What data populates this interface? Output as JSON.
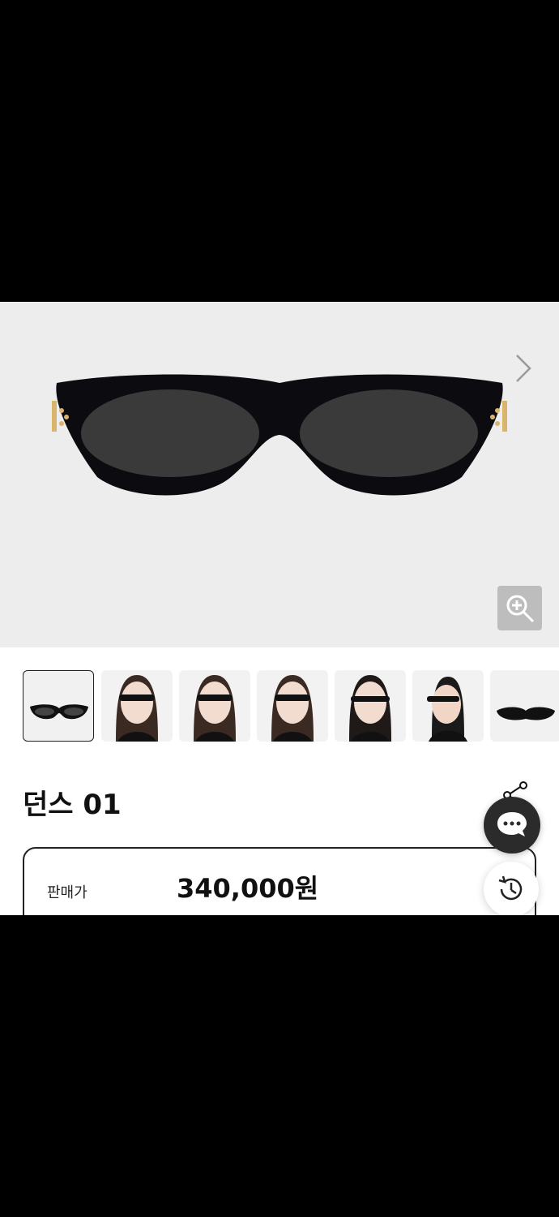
{
  "product": {
    "name": "던스 01",
    "price_label": "판매가",
    "price_value": "340,000원"
  },
  "gallery": {
    "thumbnails": [
      {
        "kind": "product",
        "selected": true
      },
      {
        "kind": "model",
        "selected": false
      },
      {
        "kind": "model",
        "selected": false
      },
      {
        "kind": "model",
        "selected": false
      },
      {
        "kind": "model",
        "selected": false
      },
      {
        "kind": "model",
        "selected": false
      },
      {
        "kind": "product-side",
        "selected": false
      }
    ]
  },
  "icons": {
    "next": "chevron-right-icon",
    "zoom": "zoom-in-icon",
    "share": "share-icon",
    "chat": "chat-icon",
    "recent": "history-icon"
  },
  "colors": {
    "hero_bg": "#ededed",
    "frame": "#0c0c10",
    "lens": "#3a3a3a",
    "gold": "#d8b56a",
    "chat_bg": "#2b2b2b"
  }
}
